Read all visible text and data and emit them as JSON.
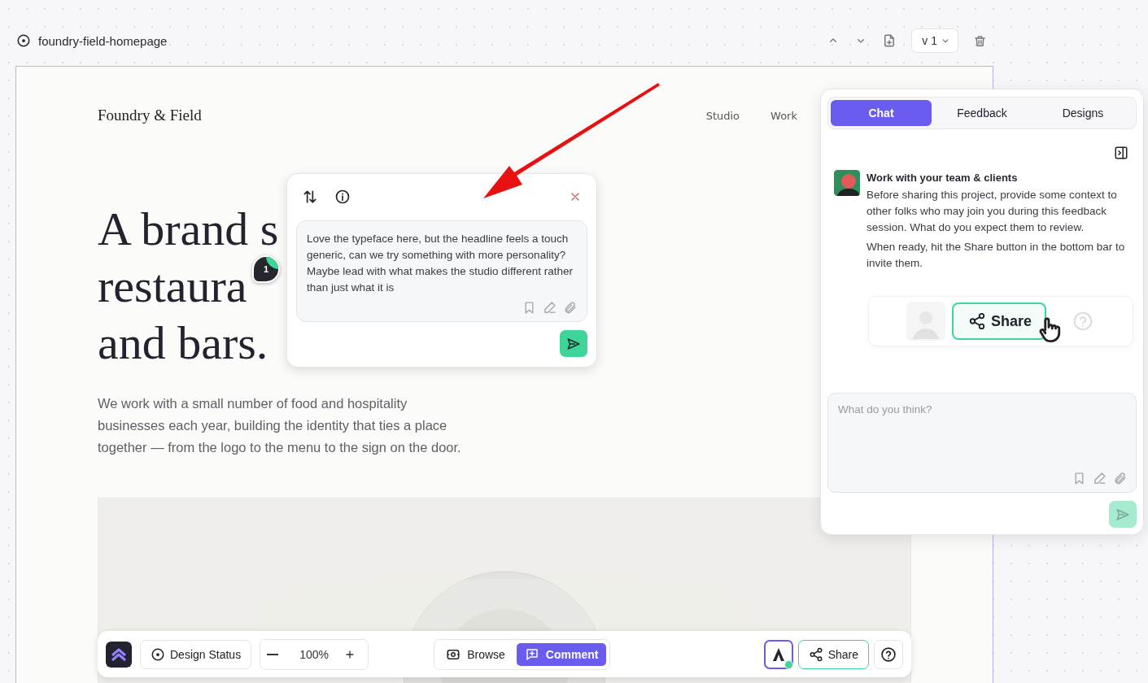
{
  "project": {
    "name": "foundry-field-homepage",
    "version": "v 1"
  },
  "site": {
    "brand": "Foundry & Field",
    "nav": [
      "Studio",
      "Work"
    ],
    "headline": [
      "A brand s",
      "restaura",
      "and bars."
    ],
    "intro": "We work with a small number of food and hospitality businesses each year, building the identity that ties a place together — from the logo to the menu to the sign on the door."
  },
  "pin": {
    "number": "1"
  },
  "comment": {
    "text": "Love the typeface here, but the headline feels a touch generic, can we try something with more personality? Maybe lead with what makes the studio different rather than just what it is",
    "can_send": true
  },
  "panel": {
    "tabs": [
      {
        "label": "Chat",
        "selected": true
      },
      {
        "label": "Feedback",
        "selected": false
      },
      {
        "label": "Designs",
        "selected": false
      }
    ],
    "message": {
      "title": "Work with your team & clients",
      "paragraphs": [
        "Before sharing this project, provide some context to other folks who may join you during this feedback session. What do you expect them to review.",
        "When ready, hit the Share button in the bottom bar to invite them."
      ]
    },
    "illustration": {
      "button": "Share"
    },
    "input": {
      "placeholder": "What do you think?"
    },
    "can_send": false
  },
  "toolbar": {
    "status_button": "Design Status",
    "zoom": "100%",
    "modes": [
      {
        "label": "Browse",
        "selected": false
      },
      {
        "label": "Comment",
        "selected": true
      }
    ],
    "share": "Share",
    "online": true
  }
}
